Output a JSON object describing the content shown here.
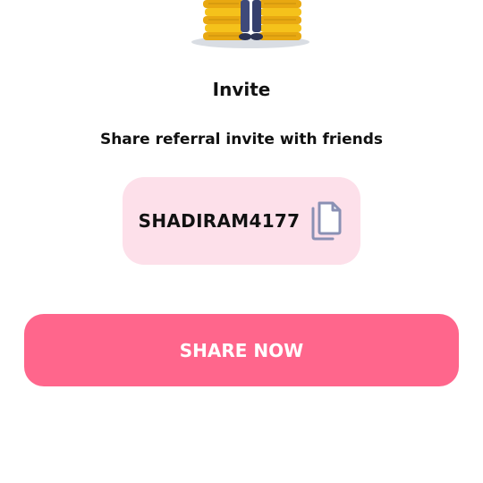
{
  "invite": {
    "title": "Invite",
    "subtitle": "Share referral invite with friends",
    "referral_code": "SHADIRAM4177",
    "copy_icon": "copy-icon",
    "share_button_label": "SHARE NOW"
  },
  "colors": {
    "code_box_bg": "#fde0ea",
    "share_button_bg": "#ff668c",
    "share_button_text": "#ffffff",
    "copy_icon": "#8a90b4"
  },
  "illustration": {
    "icon": "coin-stack-character-illustration"
  }
}
